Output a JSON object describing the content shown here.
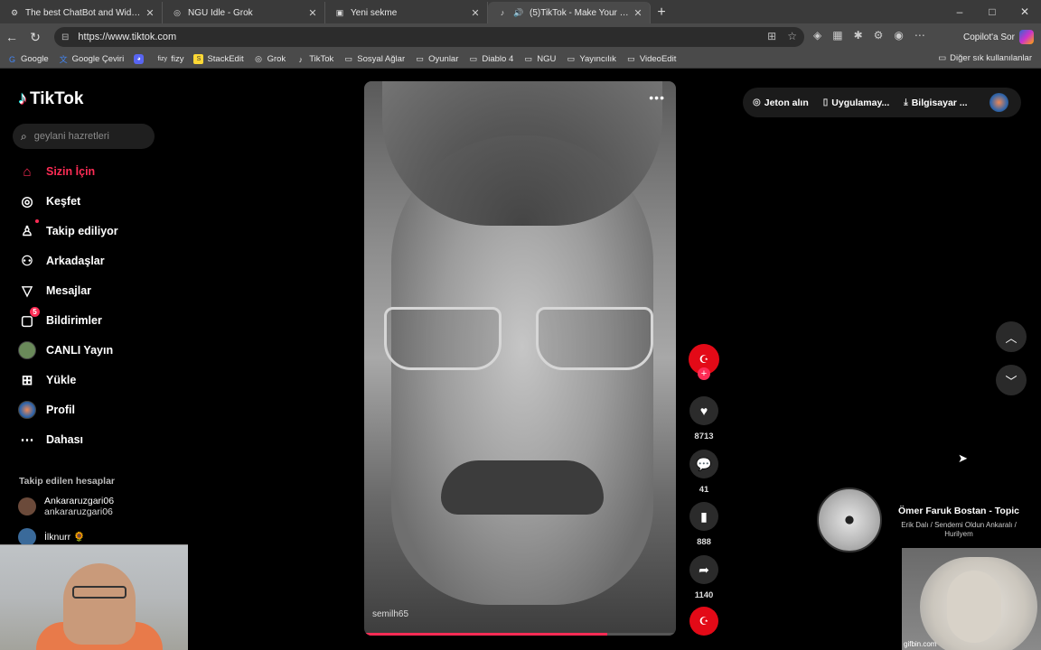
{
  "browser": {
    "tabs": [
      {
        "label": "The best ChatBot and Widgets fo",
        "icon": "gear-icon",
        "active": false
      },
      {
        "label": "NGU Idle - Grok",
        "icon": "grok-icon",
        "active": false
      },
      {
        "label": "Yeni sekme",
        "icon": "page-icon",
        "active": false
      },
      {
        "label": "(5)TikTok - Make Your Day",
        "icon": "tiktok-icon",
        "active": true
      }
    ],
    "new_tab": "+",
    "window_controls": [
      "–",
      "□",
      "✕"
    ],
    "url": "https://www.tiktok.com",
    "copilot_label": "Copilot'a Sor",
    "bookmarks": [
      {
        "label": "Google",
        "icon": "google-icon"
      },
      {
        "label": "Google Çeviri",
        "icon": "translate-icon"
      },
      {
        "label": "",
        "icon": "discord-icon"
      },
      {
        "label": "fizy",
        "icon": "fizy-icon"
      },
      {
        "label": "StackEdit",
        "icon": "stackedit-icon"
      },
      {
        "label": "Grok",
        "icon": "grok-icon"
      },
      {
        "label": "TikTok",
        "icon": "tiktok-icon"
      },
      {
        "label": "Sosyal Ağlar",
        "icon": "folder-icon"
      },
      {
        "label": "Oyunlar",
        "icon": "folder-icon"
      },
      {
        "label": "Diablo 4",
        "icon": "folder-icon"
      },
      {
        "label": "NGU",
        "icon": "folder-icon"
      },
      {
        "label": "Yayıncılık",
        "icon": "folder-icon"
      },
      {
        "label": "VideoEdit",
        "icon": "folder-icon"
      }
    ],
    "other_bookmarks": "Diğer sık kullanılanlar"
  },
  "tiktok": {
    "logo": "TikTok",
    "search_placeholder": "geylani hazretleri",
    "nav": [
      {
        "label": "Sizin İçin",
        "icon": "home-icon",
        "active": true
      },
      {
        "label": "Keşfet",
        "icon": "compass-icon"
      },
      {
        "label": "Takip ediliyor",
        "icon": "following-icon"
      },
      {
        "label": "Arkadaşlar",
        "icon": "friends-icon"
      },
      {
        "label": "Mesajlar",
        "icon": "message-icon"
      },
      {
        "label": "Bildirimler",
        "icon": "notification-icon",
        "badge": "5"
      },
      {
        "label": "CANLI Yayın",
        "icon": "live-icon"
      },
      {
        "label": "Yükle",
        "icon": "upload-icon"
      },
      {
        "label": "Profil",
        "icon": "profile-icon"
      },
      {
        "label": "Dahası",
        "icon": "more-icon"
      }
    ],
    "following_title": "Takip edilen hesaplar",
    "following": [
      {
        "name": "Ankararuzgari06",
        "handle": "ankararuzgari06"
      },
      {
        "name": "İlknurr 🌻",
        "handle": ""
      }
    ],
    "video": {
      "username": "semilh65",
      "progress": 0.78
    },
    "actions": {
      "like_count": "8713",
      "comment_count": "41",
      "save_count": "888",
      "share_count": "1140"
    },
    "top_right": {
      "coins": "Jeton alın",
      "app": "Uygulamay...",
      "pc": "Bilgisayar ..."
    },
    "music": {
      "title": "Ömer Faruk Bostan - Topic",
      "subtitle": "Erik Dalı / Sendemi Oldun Ankaralı / Hurilyem"
    }
  },
  "overlays": {
    "sheep_watermark": "gifbin.com"
  }
}
